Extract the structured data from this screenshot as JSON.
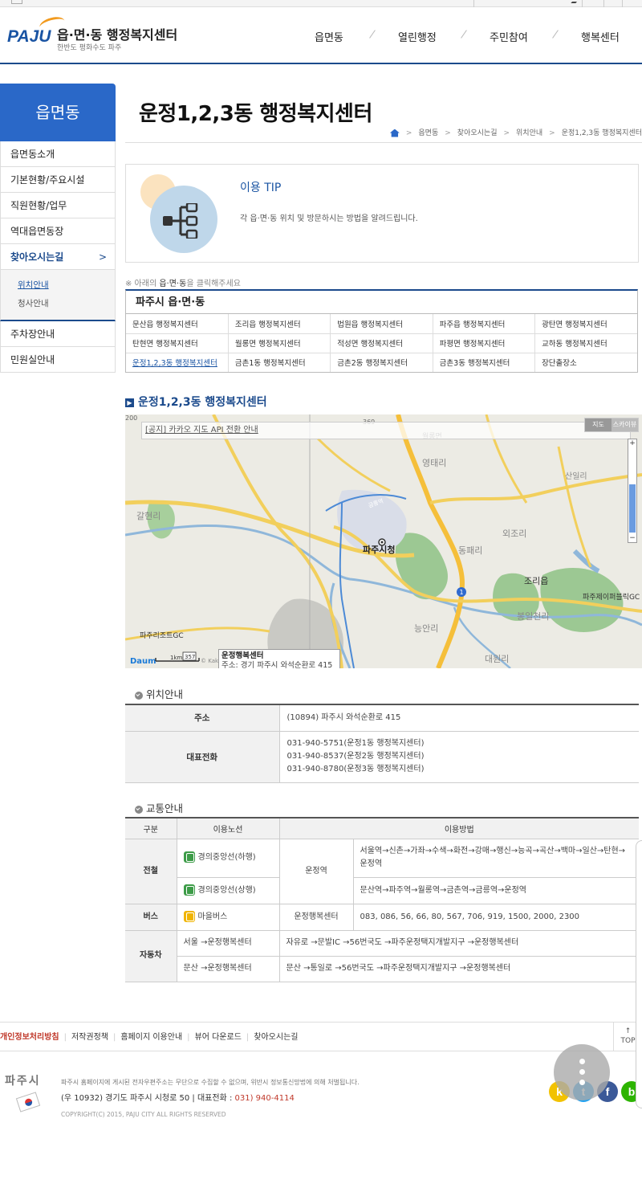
{
  "header": {
    "logo_mark": "PAJU",
    "site_name": "읍·면·동 행정복지센터",
    "site_sub": "한반도 평화수도 파주",
    "nav": [
      "읍면동",
      "열린행정",
      "주민참여",
      "행복센터"
    ]
  },
  "lnb": {
    "title": "읍면동",
    "items": [
      "읍면동소개",
      "기본현황/주요시설",
      "직원현황/업무",
      "역대읍면동장",
      "찾아오시는길"
    ],
    "active_chev": ">",
    "sub_items": [
      "위치안내",
      "청사안내"
    ],
    "items_after": [
      "주차장안내",
      "민원실안내"
    ]
  },
  "page": {
    "title": "운정1,2,3동 행정복지센터",
    "breadcrumb": [
      "읍면동",
      "찾아오시는길",
      "위치안내",
      "운정1,2,3동 행정복지센터"
    ],
    "breadcrumb_sep": ">"
  },
  "tip": {
    "title": "이용 TIP",
    "desc": "각 읍·면·동 위치 및 방문하시는 방법을 알려드립니다."
  },
  "notice": {
    "prefix": "※ 아래의 ",
    "bold": "읍·면·동",
    "suffix": "을 클릭해주세요"
  },
  "dong_table": {
    "title": "파주시 읍·면·동",
    "rows": [
      [
        "문산읍 행정복지센터",
        "조리읍 행정복지센터",
        "법원읍 행정복지센터",
        "파주읍 행정복지센터",
        "광탄면 행정복지센터"
      ],
      [
        "탄현면 행정복지센터",
        "월롱면 행정복지센터",
        "적성면 행정복지센터",
        "파평면 행정복지센터",
        "교하동 행정복지센터"
      ],
      [
        "운정1,2,3동 행정복지센터",
        "금촌1동 행정복지센터",
        "금촌2동 행정복지센터",
        "금촌3동 행정복지센터",
        "장단출장소"
      ]
    ]
  },
  "map_section": {
    "title": "운정1,2,3동 행정복지센터",
    "icon_char": "▶",
    "notice": "[공지] 카카오 지도 API 전환 안내",
    "type_buttons": [
      "지도",
      "스카이뷰"
    ],
    "zoom_plus": "+",
    "zoom_minus": "−",
    "labels": {
      "city_hall": "파주시청",
      "youngtae": "영태리",
      "galhyeon": "갈현리",
      "dongpae": "동패리",
      "oejo": "외조리",
      "jori": "조리읍",
      "bongil": "봉일천리",
      "nongan": "능안리",
      "daewon": "대원리",
      "wolrong": "월롱면",
      "sanil": "산일리",
      "resort": "파주리조트GC",
      "premium": "파주제이퍼블릭GC",
      "route1": "1",
      "rt369": "369",
      "geumneung": "금릉역",
      "scale": "1km",
      "scale_route": "357",
      "copyright": "© Kakao",
      "daum": "Daum",
      "tick_200": "200"
    },
    "popup_title": "운정행복센터",
    "popup_addr": "주소: 경기 파주시 와석순환로 415"
  },
  "location": {
    "section_title": "위치안내",
    "address_label": "주소",
    "address": "(10894) 파주시 와석순환로 415",
    "phone_label": "대표전화",
    "phones": [
      "031-940-5751(운정1동 행정복지센터)",
      "031-940-8537(운정2동 행정복지센터)",
      "031-940-8780(운정3동 행정복지센터)"
    ]
  },
  "transport": {
    "section_title": "교통안내",
    "headers": [
      "구분",
      "이용노선",
      "이용방법"
    ],
    "rail_cat": "전철",
    "rail_line1": "경의중앙선(하행)",
    "rail_line2": "경의중앙선(상행)",
    "rail_station": "운정역",
    "rail_route1": "서울역→신촌→가좌→수색→화전→강매→행신→능곡→곡산→백마→일산→탄현→운정역",
    "rail_route2": "문산역→파주역→월롱역→금촌역→금릉역→운정역",
    "bus_cat": "버스",
    "bus_line": "마을버스",
    "bus_stop": "운정행복센터",
    "bus_routes": "083, 086, 56, 66, 80, 567, 706, 919, 1500, 2000, 2300",
    "car_cat": "자동차",
    "car_line1": "서울 →운정행복센터",
    "car_route1": "자유로 →문발IC →56번국도 →파주운정택지개발지구 →운정행복센터",
    "car_line2": "문산 →운정행복센터",
    "car_route2": "문산 →통일로 →56번국도 →파주운정택지개발지구 →운정행복센터"
  },
  "footer": {
    "links": [
      "개인정보처리방침",
      "저작권정책",
      "홈페이지 이용안내",
      "뷰어 다운로드",
      "찾아오시는길"
    ],
    "top_arrow": "↑",
    "top_label": "TOP",
    "logo_text": "파주시",
    "notice": "파주시 홈페이지에 게시된 전자우편주소는 무단으로 수집할 수 없으며, 위반시 정보통신망법에 의해 처벌됩니다.",
    "address": "(우 10932) 경기도 파주시 시청로 50 | 대표전화 : ",
    "phone": "031) 940-4114",
    "copyright": "COPYRIGHT(C) 2015, PAJU CITY ALL RIGHTS RESERVED",
    "social": [
      "k",
      "t",
      "f",
      "b"
    ]
  },
  "colors": {
    "brand": "#1b4a8c",
    "lnb_head": "#2a68c8",
    "privacy_red": "#c0392b"
  }
}
